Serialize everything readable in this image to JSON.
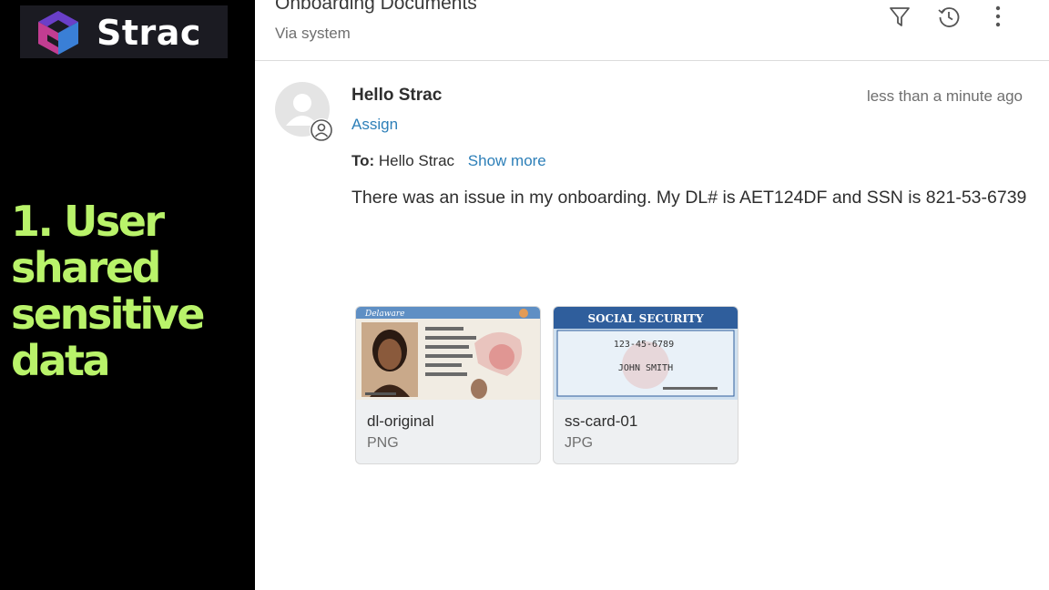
{
  "branding": {
    "name": "Strac"
  },
  "caption": [
    "1. User",
    "shared",
    "sensitive",
    "data"
  ],
  "ticket": {
    "subject": "Onboarding Documents",
    "via": "Via system"
  },
  "toolbar": {
    "icons": [
      "filter-icon",
      "history-icon",
      "more-vertical-icon"
    ]
  },
  "message": {
    "sender": "Hello Strac",
    "timestamp": "less than a minute ago",
    "assign_label": "Assign",
    "to_label": "To:",
    "to_value": "Hello Strac",
    "show_more_label": "Show more",
    "body": "There was an issue in my onboarding. My DL# is AET124DF and SSN is 821-53-6739"
  },
  "attachments": [
    {
      "name": "dl-original",
      "type": "PNG",
      "image_text": "Delaware"
    },
    {
      "name": "ss-card-01",
      "type": "JPG",
      "image_text": [
        "SOCIAL SECURITY",
        "123-45-6789",
        "JOHN SMITH"
      ]
    }
  ],
  "colors": {
    "caption": "#b9f36a",
    "link": "#2d7fb8",
    "left_panel": "#000000"
  }
}
